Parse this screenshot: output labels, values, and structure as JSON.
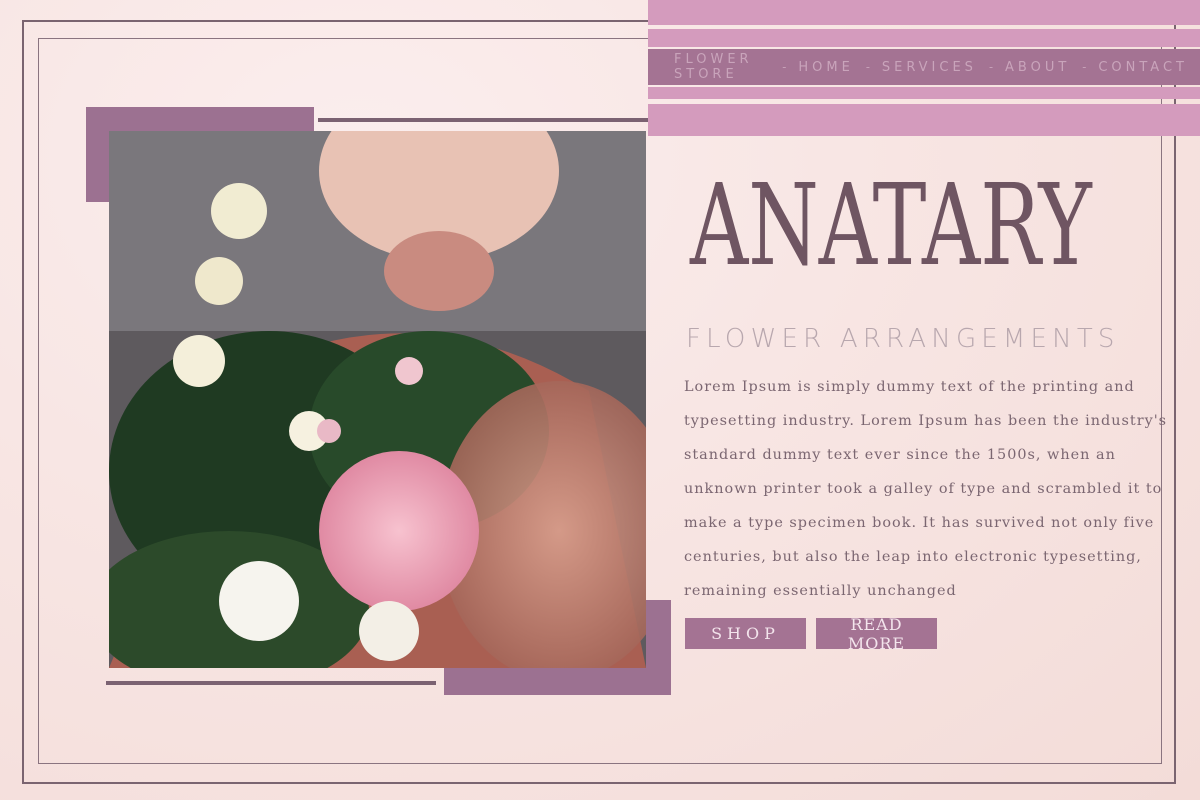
{
  "nav": {
    "items": [
      "FLOWER STORE",
      "HOME",
      "SERVICES",
      "ABOUT",
      "CONTACT"
    ]
  },
  "hero": {
    "title": "ANATARY",
    "subtitle": "FLOWER ARRANGEMENTS",
    "body": "Lorem Ipsum is simply dummy text of the printing and typesetting industry. Lorem Ipsum has been the industry's standard dummy text ever since the 1500s, when an unknown printer took a galley of type and scrambled it to make a type specimen book. It has survived not only five centuries, but also the leap into electronic typesetting, remaining essentially unchanged",
    "shop_label": "SHOP",
    "read_more_label": "READ MORE"
  },
  "colors": {
    "accent": "#a47393",
    "light_accent": "#d49bbd",
    "title": "#6f5562"
  }
}
